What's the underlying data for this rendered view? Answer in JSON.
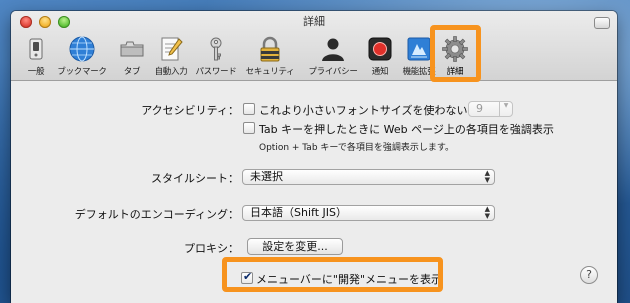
{
  "window": {
    "title": "詳細"
  },
  "toolbar": {
    "items": [
      {
        "label": "一般",
        "icon": "switch-icon"
      },
      {
        "label": "ブックマーク",
        "icon": "globe-icon"
      },
      {
        "label": "タブ",
        "icon": "tabs-icon"
      },
      {
        "label": "自動入力",
        "icon": "pencil-form-icon"
      },
      {
        "label": "パスワード",
        "icon": "key-icon"
      },
      {
        "label": "セキュリティ",
        "icon": "lock-icon"
      },
      {
        "label": "プライバシー",
        "icon": "person-icon"
      },
      {
        "label": "通知",
        "icon": "notification-icon"
      },
      {
        "label": "機能拡張",
        "icon": "extensions-icon"
      },
      {
        "label": "詳細",
        "icon": "gear-icon"
      }
    ],
    "selected": "詳細"
  },
  "accessibility": {
    "label": "アクセシビリティ：",
    "min_font_checkbox_label": "これより小さいフォントサイズを使わない：",
    "min_font_checked": false,
    "min_font_value": "9",
    "tab_highlight_label": "Tab キーを押したときに Web ページ上の各項目を強調表示",
    "tab_highlight_checked": false,
    "tab_hint": "Option + Tab キーで各項目を強調表示します。"
  },
  "stylesheet": {
    "label": "スタイルシート：",
    "value": "未選択"
  },
  "encoding": {
    "label": "デフォルトのエンコーディング：",
    "value": "日本語（Shift JIS）"
  },
  "proxy": {
    "label": "プロキシ：",
    "button_label": "設定を変更..."
  },
  "develop_menu": {
    "label": "メニューバーに\"開発\"メニューを表示",
    "checked": true
  },
  "help": {
    "label": "?"
  },
  "colors": {
    "highlight": "#f7931e",
    "window_bg": "#ececec",
    "desktop": "#2f6aa8"
  }
}
